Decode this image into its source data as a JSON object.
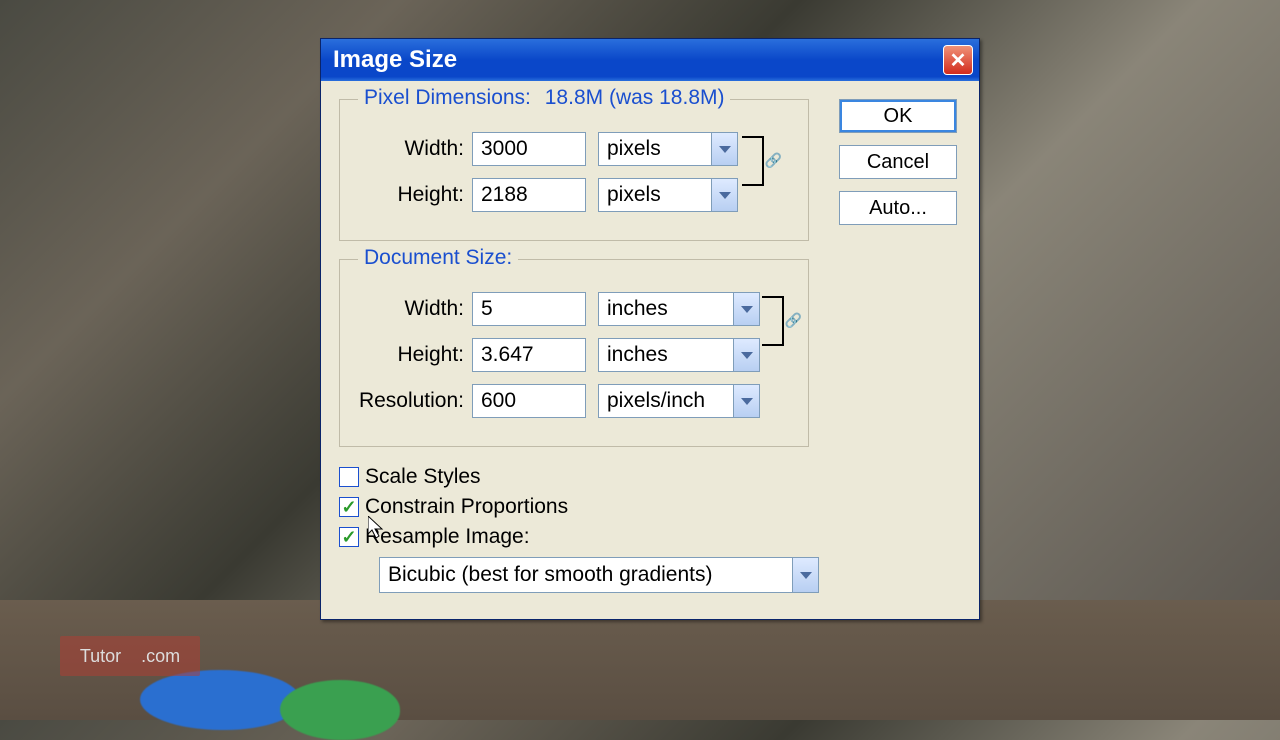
{
  "dialog": {
    "title": "Image Size",
    "pixel_dimensions": {
      "legend_prefix": "Pixel Dimensions:",
      "size_text": "18.8M (was 18.8M)",
      "width_label": "Width:",
      "width_value": "3000",
      "width_unit": "pixels",
      "height_label": "Height:",
      "height_value": "2188",
      "height_unit": "pixels"
    },
    "document_size": {
      "legend": "Document Size:",
      "width_label": "Width:",
      "width_value": "5",
      "width_unit": "inches",
      "height_label": "Height:",
      "height_value": "3.647",
      "height_unit": "inches",
      "resolution_label": "Resolution:",
      "resolution_value": "600",
      "resolution_unit": "pixels/inch"
    },
    "checks": {
      "scale_styles": {
        "label": "Scale Styles",
        "checked": false
      },
      "constrain": {
        "label": "Constrain Proportions",
        "checked": true
      },
      "resample": {
        "label": "Resample Image:",
        "checked": true
      },
      "resample_method": "Bicubic (best for smooth gradients)"
    },
    "buttons": {
      "ok": "OK",
      "cancel": "Cancel",
      "auto": "Auto..."
    }
  },
  "watermark": {
    "left": "Tutor",
    "right": ".com"
  }
}
